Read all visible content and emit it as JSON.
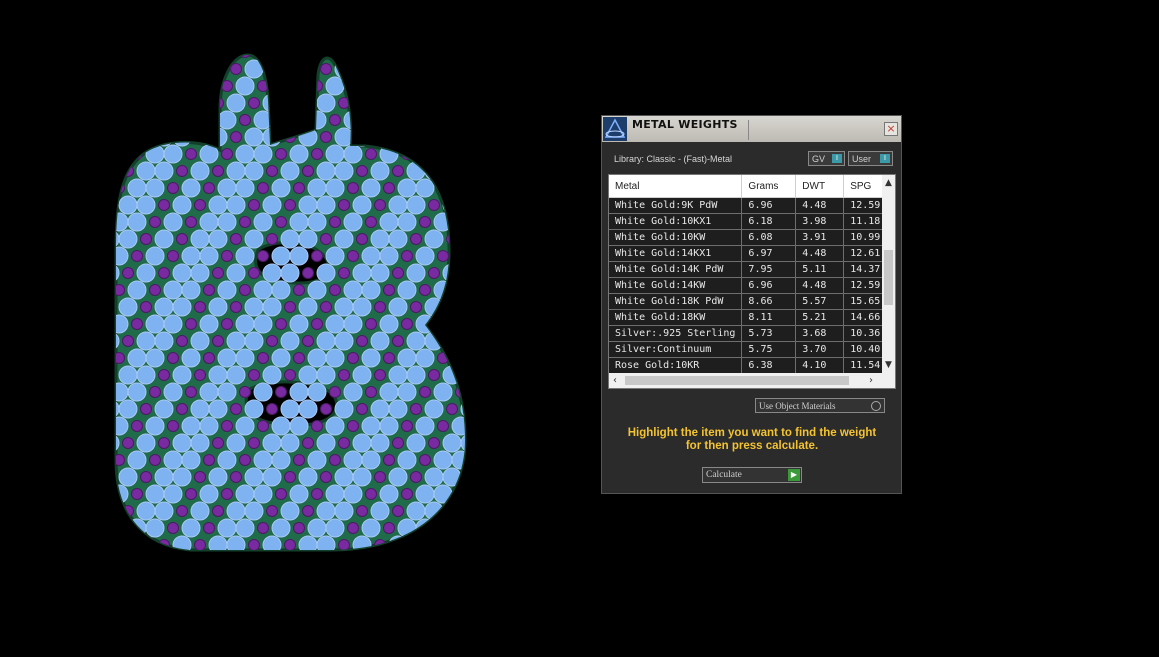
{
  "window": {
    "title": "METAL WEIGHTS",
    "close_label": "×"
  },
  "library": {
    "label": "Library: Classic - (Fast)-Metal"
  },
  "toggles": {
    "gv_label": "GV",
    "user_label": "User"
  },
  "table": {
    "columns": [
      "Metal",
      "Grams",
      "DWT",
      "SPG"
    ],
    "rows": [
      [
        "White Gold:9K PdW",
        "6.96",
        "4.48",
        "12.59"
      ],
      [
        "White Gold:10KX1",
        "6.18",
        "3.98",
        "11.18"
      ],
      [
        "White Gold:10KW",
        "6.08",
        "3.91",
        "10.99"
      ],
      [
        "White Gold:14KX1",
        "6.97",
        "4.48",
        "12.61"
      ],
      [
        "White Gold:14K PdW",
        "7.95",
        "5.11",
        "14.37"
      ],
      [
        "White Gold:14KW",
        "6.96",
        "4.48",
        "12.59"
      ],
      [
        "White Gold:18K PdW",
        "8.66",
        "5.57",
        "15.65"
      ],
      [
        "White Gold:18KW",
        "8.11",
        "5.21",
        "14.66"
      ],
      [
        "Silver:.925 Sterling",
        "5.73",
        "3.68",
        "10.36"
      ],
      [
        "Silver:Continuum",
        "5.75",
        "3.70",
        "10.40"
      ],
      [
        "Rose Gold:10KR",
        "6.38",
        "4.10",
        "11.54"
      ]
    ]
  },
  "use_object_materials": {
    "label": "Use Object Materials"
  },
  "instruction": {
    "line1": "Highlight the item you want to find the weight",
    "line2": "for then press calculate."
  },
  "calculate": {
    "label": "Calculate"
  },
  "colors": {
    "accent_text": "#f3c331",
    "panel_bg": "#2b2b2b",
    "stone_light": "#7fb2f0",
    "stone_dark": "#7a2aa0",
    "metal": "#1f6b4a"
  }
}
